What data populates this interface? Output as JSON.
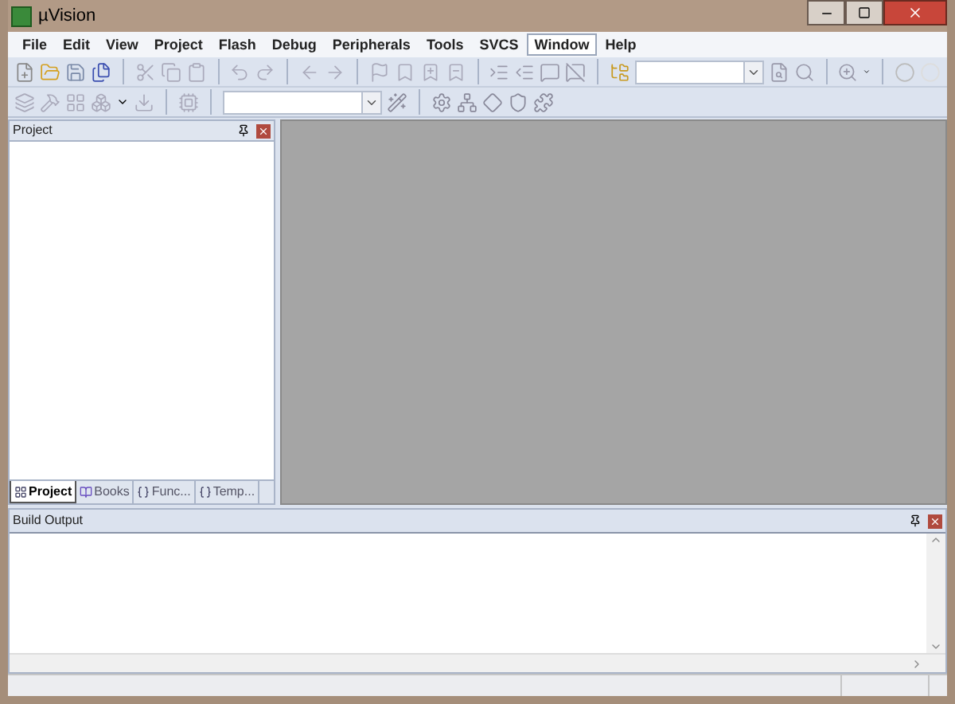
{
  "window": {
    "title": "µVision"
  },
  "menu": [
    {
      "label": "File",
      "selected": false
    },
    {
      "label": "Edit",
      "selected": false
    },
    {
      "label": "View",
      "selected": false
    },
    {
      "label": "Project",
      "selected": false
    },
    {
      "label": "Flash",
      "selected": false
    },
    {
      "label": "Debug",
      "selected": false
    },
    {
      "label": "Peripherals",
      "selected": false
    },
    {
      "label": "Tools",
      "selected": false
    },
    {
      "label": "SVCS",
      "selected": false
    },
    {
      "label": "Window",
      "selected": true
    },
    {
      "label": "Help",
      "selected": false
    }
  ],
  "project_panel": {
    "title": "Project",
    "tabs": [
      {
        "label": "Project",
        "selected": true
      },
      {
        "label": "Books",
        "selected": false
      },
      {
        "label": "Func...",
        "selected": false
      },
      {
        "label": "Temp...",
        "selected": false
      }
    ]
  },
  "build_output": {
    "title": "Build Output"
  }
}
